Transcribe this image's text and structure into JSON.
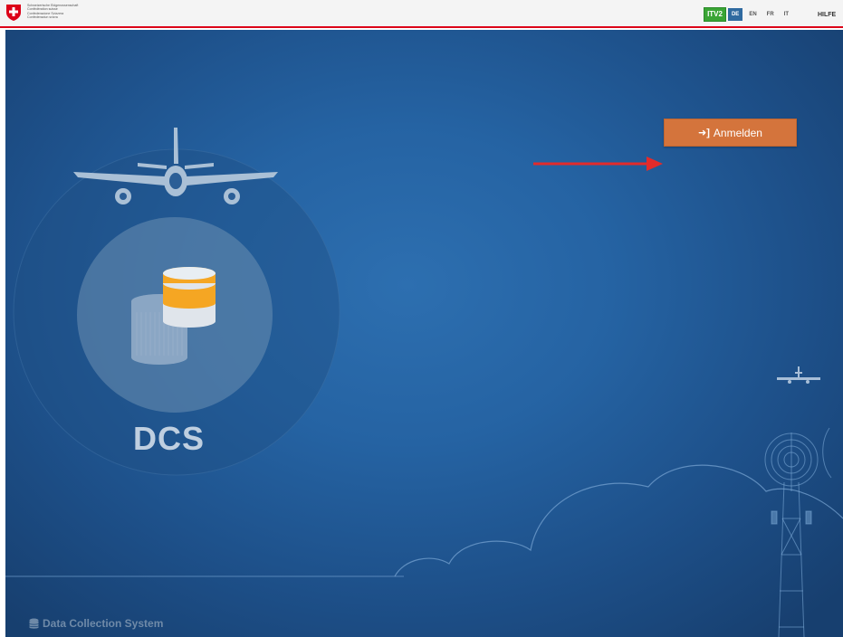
{
  "header": {
    "agency_lines": [
      "Schweizerische Eidgenossenschaft",
      "Confédération suisse",
      "Confederazione Svizzera",
      "Confederaziun svizra"
    ],
    "app_badge": "ITV2",
    "languages": [
      "DE",
      "EN",
      "FR",
      "IT"
    ],
    "active_language": "DE",
    "help_label": "HILFE"
  },
  "main": {
    "login_label": "Anmelden",
    "app_short_name": "DCS",
    "footer_label": "Data Collection System"
  },
  "colors": {
    "accent_button": "#d4743c",
    "language_active": "#2f6aa0",
    "badge": "#3aa535",
    "arrow": "#e32b2b",
    "background": "#2563a3"
  },
  "icons": [
    "swiss-flag-icon",
    "sign-in-icon",
    "database-icon",
    "airplane-icon",
    "cloud-icon",
    "radio-tower-icon"
  ]
}
